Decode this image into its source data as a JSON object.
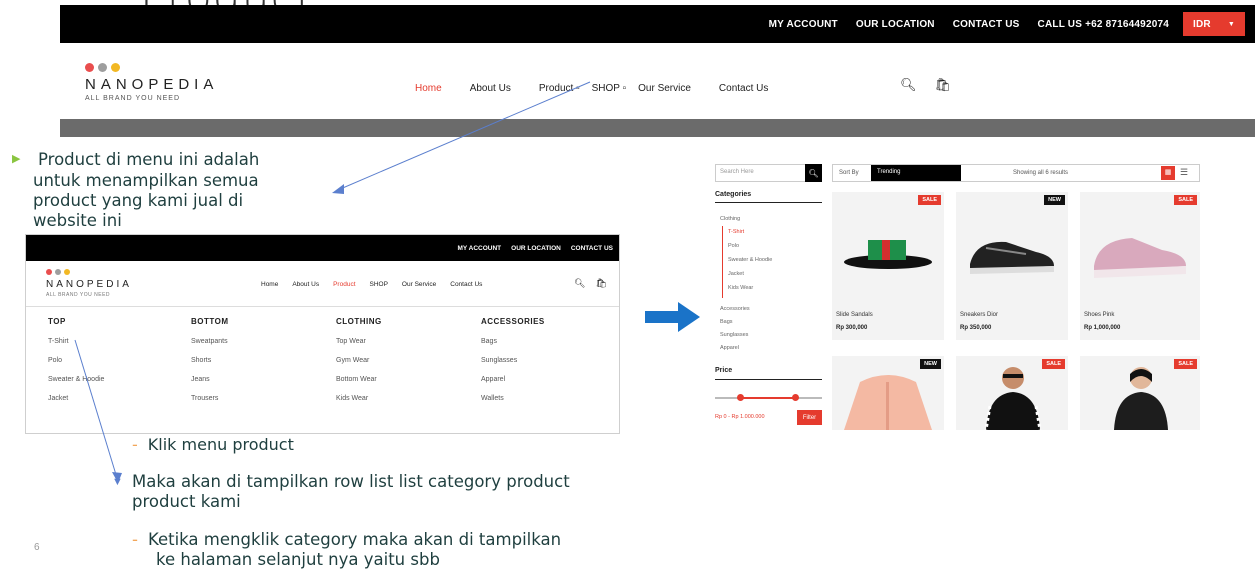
{
  "slide": {
    "title": "Product",
    "page_number": "6",
    "note1_lines": [
      "Product di menu ini adalah",
      "untuk menampilkan semua",
      "product yang kami jual di",
      "website ini"
    ],
    "note2": "Klik menu product",
    "note3_lines": [
      "Maka akan di tampilkan row list list category product",
      "product kami"
    ],
    "note4_lines": [
      "Ketika mengklik category maka akan di tampilkan",
      "ke halaman selanjut nya yaitu sbb"
    ]
  },
  "topbar": {
    "links": [
      "MY ACCOUNT",
      "OUR LOCATION",
      "CONTACT US",
      "CALL US +62 87164492074"
    ],
    "currency": "IDR"
  },
  "brand": {
    "name": "NANOPEDIA",
    "tagline": "ALL BRAND YOU NEED",
    "dot_colors": [
      "#e94e4e",
      "#9e9e9e",
      "#f2b824"
    ]
  },
  "menu": {
    "items": [
      "Home",
      "About Us",
      "Product",
      "SHOP",
      "Our Service",
      "Contact Us"
    ],
    "active": "Home"
  },
  "mega_menu": {
    "columns": [
      {
        "title": "TOP",
        "items": [
          "T-Shirt",
          "Polo",
          "Sweater & Hoodie",
          "Jacket"
        ]
      },
      {
        "title": "BOTTOM",
        "items": [
          "Sweatpants",
          "Shorts",
          "Jeans",
          "Trousers"
        ]
      },
      {
        "title": "CLOTHING",
        "items": [
          "Top Wear",
          "Gym Wear",
          "Bottom Wear",
          "Kids Wear"
        ]
      },
      {
        "title": "ACCESSORIES",
        "items": [
          "Bags",
          "Sunglasses",
          "Apparel",
          "Wallets"
        ]
      }
    ]
  },
  "shop": {
    "search_placeholder": "Search Here",
    "sort_label": "Sort By",
    "sort_value": "Trending",
    "showing": "Showing all 6 results",
    "categories_title": "Categories",
    "categories": [
      "Clothing",
      "T-Shirt",
      "Polo",
      "Sweater & Hoodie",
      "Jacket",
      "Kids Wear",
      "Accessories",
      "Bags",
      "Sunglasses",
      "Apparel"
    ],
    "price_title": "Price",
    "price_range": "Rp 0 - Rp 1.000.000",
    "filter_label": "Filter",
    "products": [
      {
        "name": "Slide Sandals",
        "price": "Rp 300,000",
        "badge": "SALE",
        "badge_color": "red"
      },
      {
        "name": "Sneakers Dior",
        "price": "Rp 350,000",
        "badge": "NEW",
        "badge_color": "black"
      },
      {
        "name": "Shoes Pink",
        "price": "Rp 1,000,000",
        "badge": "SALE",
        "badge_color": "red"
      },
      {
        "name": "",
        "price": "",
        "badge": "NEW",
        "badge_color": "black"
      },
      {
        "name": "",
        "price": "",
        "badge": "SALE",
        "badge_color": "red"
      },
      {
        "name": "",
        "price": "",
        "badge": "SALE",
        "badge_color": "red"
      }
    ]
  }
}
